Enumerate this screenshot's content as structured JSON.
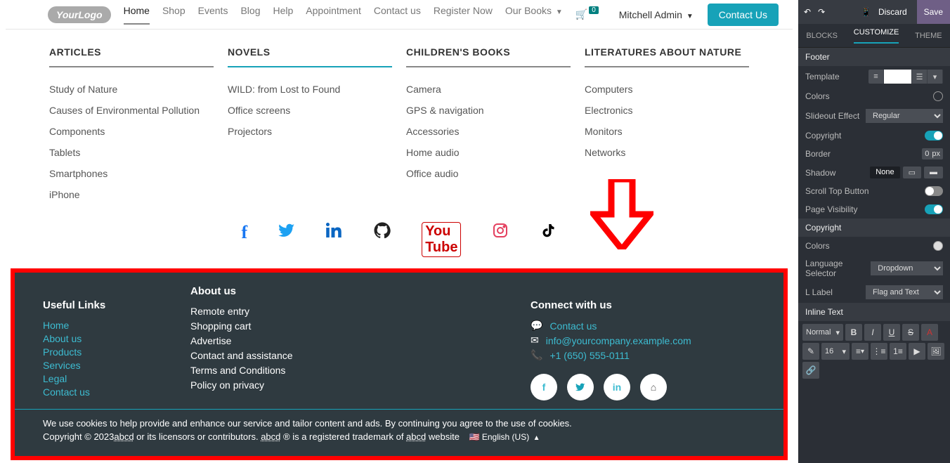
{
  "header": {
    "logo_text": "YourLogo",
    "nav": [
      "Home",
      "Shop",
      "Events",
      "Blog",
      "Help",
      "Appointment",
      "Contact us",
      "Register Now",
      "Our Books"
    ],
    "active_index": 0,
    "bold_index": 8,
    "cart_count": "0",
    "user": "Mitchell Admin",
    "contact_btn": "Contact Us"
  },
  "mega": {
    "cols": [
      {
        "title": "ARTICLES",
        "items": [
          "Study of Nature",
          "Causes of Environmental Pollution",
          "Components",
          "Tablets",
          "Smartphones",
          "iPhone"
        ]
      },
      {
        "title": "NOVELS",
        "items": [
          "WILD: from Lost to Found",
          "Office screens",
          "Projectors"
        ]
      },
      {
        "title": "CHILDREN'S BOOKS",
        "items": [
          "Camera",
          "GPS & navigation",
          "Accessories",
          "Home audio",
          "Office audio"
        ]
      },
      {
        "title": "LITERATURES ABOUT NATURE",
        "items": [
          "Computers",
          "Electronics",
          "Monitors",
          "Networks"
        ]
      }
    ]
  },
  "footer": {
    "useful_title": "Useful Links",
    "useful": [
      "Home",
      "About us",
      "Products",
      "Services",
      "Legal",
      "Contact us"
    ],
    "about_title": "About us",
    "about": [
      "Remote entry",
      "Shopping cart",
      "Advertise",
      "Contact and assistance",
      "Terms and Conditions",
      "Policy on privacy"
    ],
    "connect_title": "Connect with us",
    "contact_label": "Contact us",
    "email": "info@yourcompany.example.com",
    "phone": "+1 (650) 555-0111",
    "cookies": "We use cookies to help provide and enhance our service and tailor content and ads. By continuing you agree to the use of cookies.",
    "copy_pre": "Copyright © 2023",
    "copy_mid1": "abcd",
    "copy_mid2": " or its licensors or contributors. ",
    "copy_mid3": "abcd",
    "copy_mid4": " ® is a registered trademark of ",
    "copy_mid5": "abcd",
    "copy_post": " website",
    "lang": "English (US)"
  },
  "sidepanel": {
    "discard": "Discard",
    "save": "Save",
    "tabs": [
      "BLOCKS",
      "CUSTOMIZE",
      "THEME"
    ],
    "active_tab": 1,
    "sec_footer": "Footer",
    "template": "Template",
    "colors": "Colors",
    "slideout": "Slideout Effect",
    "slideout_val": "Regular",
    "copyright": "Copyright",
    "border": "Border",
    "border_val": "0",
    "border_unit": "px",
    "shadow": "Shadow",
    "shadow_val": "None",
    "scrolltop": "Scroll Top Button",
    "pagevis": "Page Visibility",
    "sec_copy": "Copyright",
    "c_colors": "Colors",
    "lang_sel": "Language Selector",
    "lang_sel_val": "Dropdown",
    "lang_label": "Label",
    "lang_label_icon": "L",
    "lang_label_val": "Flag and Text",
    "sec_inline": "Inline Text",
    "fontsel": "Normal",
    "fontsize": "16"
  }
}
